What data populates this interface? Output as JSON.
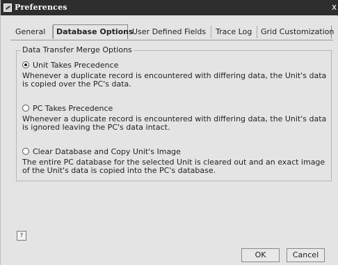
{
  "window": {
    "title": "Preferences",
    "close_glyph": "x"
  },
  "tabs": [
    {
      "label": "General"
    },
    {
      "label": "Database Options"
    },
    {
      "label": "User Defined Fields"
    },
    {
      "label": "Trace Log"
    },
    {
      "label": "Grid Customization"
    }
  ],
  "group": {
    "title": "Data Transfer Merge Options",
    "options": [
      {
        "label": "Unit Takes Precedence",
        "checked": true,
        "description": "Whenever a duplicate record is encountered with differing data, the Unit's data is copied over the PC's data."
      },
      {
        "label": "PC Takes Precedence",
        "checked": false,
        "description": "Whenever a duplicate record is encountered with differing data, the Unit's data is ignored leaving the PC's data intact."
      },
      {
        "label": "Clear Database and Copy Unit's Image",
        "checked": false,
        "description": "The entire PC database for the selected Unit is cleared out and an exact image of the Unit's data is copied into the PC's database."
      }
    ]
  },
  "buttons": {
    "ok": "OK",
    "cancel": "Cancel"
  },
  "icons": {
    "window_icon": "preferences-icon",
    "help": "help-icon"
  }
}
